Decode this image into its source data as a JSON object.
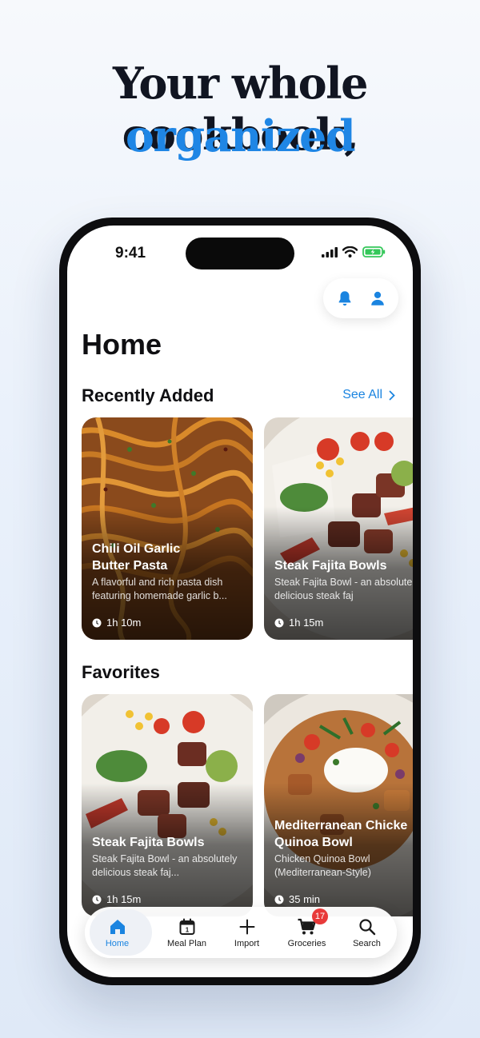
{
  "headline": {
    "line1": "Your whole cookbook,",
    "line2": "organized"
  },
  "status_bar": {
    "time": "9:41"
  },
  "page": {
    "title": "Home"
  },
  "recently_added": {
    "title": "Recently Added",
    "see_all": "See All",
    "cards": [
      {
        "title": "Chili Oil Garlic\nButter Pasta",
        "description": "A flavorful and rich pasta dish featuring homemade garlic b...",
        "time": "1h 10m"
      },
      {
        "title": "Steak Fajita Bowls",
        "description": "Steak Fajita Bowl - an absolutely delicious steak faj",
        "time": "1h 15m"
      }
    ]
  },
  "favorites": {
    "title": "Favorites",
    "cards": [
      {
        "title": "Steak Fajita Bowls",
        "description": "Steak Fajita Bowl - an absolutely delicious steak faj...",
        "time": "1h 15m"
      },
      {
        "title": "Mediterranean Chicke\nQuinoa Bowl",
        "description": "Chicken Quinoa Bowl (Mediterranean-Style)",
        "time": "35 min"
      }
    ]
  },
  "tabbar": {
    "tabs": [
      {
        "label": "Home",
        "icon": "home-icon",
        "active": true
      },
      {
        "label": "Meal Plan",
        "icon": "calendar-icon",
        "calendar_day": "1"
      },
      {
        "label": "Import",
        "icon": "plus-icon"
      },
      {
        "label": "Groceries",
        "icon": "cart-icon",
        "badge": "17"
      },
      {
        "label": "Search",
        "icon": "search-icon"
      }
    ]
  },
  "colors": {
    "accent": "#1a84e0",
    "badge": "#e83a3a",
    "headline_dark": "#111521",
    "headline_blue": "#1f86e5"
  }
}
